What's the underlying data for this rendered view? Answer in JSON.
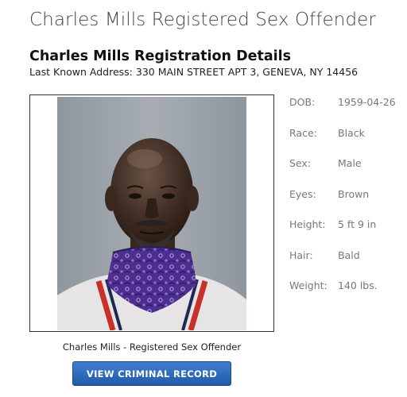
{
  "header": {
    "page_title": "Charles Mills Registered Sex Offender",
    "section_title": "Charles Mills Registration Details",
    "address": "Last Known Address: 330 MAIN STREET APT 3, GENEVA, NY 14456"
  },
  "photo": {
    "caption": "Charles Mills - Registered Sex Offender"
  },
  "button": {
    "label": "VIEW CRIMINAL RECORD",
    "color": "#2f6bbf"
  },
  "details": [
    {
      "label": "DOB:",
      "value": "1959-04-26"
    },
    {
      "label": "Race:",
      "value": "Black"
    },
    {
      "label": "Sex:",
      "value": "Male"
    },
    {
      "label": "Eyes:",
      "value": "Brown"
    },
    {
      "label": "Height:",
      "value": "5 ft 9 in"
    },
    {
      "label": "Hair:",
      "value": "Bald"
    },
    {
      "label": "Weight:",
      "value": "140 lbs."
    }
  ]
}
